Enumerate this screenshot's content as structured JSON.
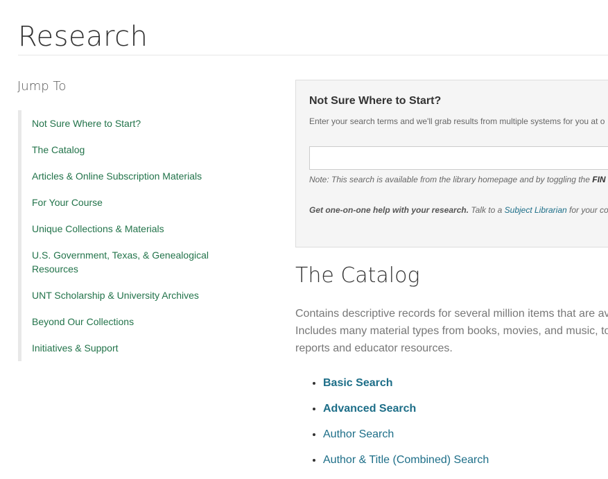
{
  "page": {
    "title": "Research"
  },
  "jump_to": {
    "heading": "Jump To",
    "items": [
      "Not Sure Where to Start?",
      "The Catalog",
      "Articles & Online Subscription Materials",
      "For Your Course",
      "Unique Collections & Materials",
      "U.S. Government, Texas, & Genealogical Resources",
      "UNT Scholarship & University Archives",
      "Beyond Our Collections",
      "Initiatives & Support"
    ]
  },
  "help_box": {
    "title": "Not Sure Where to Start?",
    "description": "Enter your search terms and we'll grab results from multiple systems for you at o",
    "search_value": "",
    "note_prefix": "Note: This search is available from the library homepage and by toggling the ",
    "note_bold": "FIN",
    "help_bold": "Get one-on-one help with your research.",
    "help_text": " Talk to a ",
    "help_link": "Subject Librarian",
    "help_suffix": " for your co"
  },
  "catalog": {
    "title": "The Catalog",
    "description_lines": [
      "Contains descriptive records for several million items that are av",
      "Includes many material types from books, movies, and music, to",
      "reports and educator resources."
    ],
    "links": [
      {
        "label": "Basic Search"
      },
      {
        "label": "Advanced Search"
      },
      {
        "label": "Author Search"
      },
      {
        "label": "Author & Title (Combined) Search"
      }
    ]
  },
  "colors": {
    "nav_link": "#22734a",
    "link": "#1d6e88",
    "box_bg": "#f5f5f5"
  }
}
